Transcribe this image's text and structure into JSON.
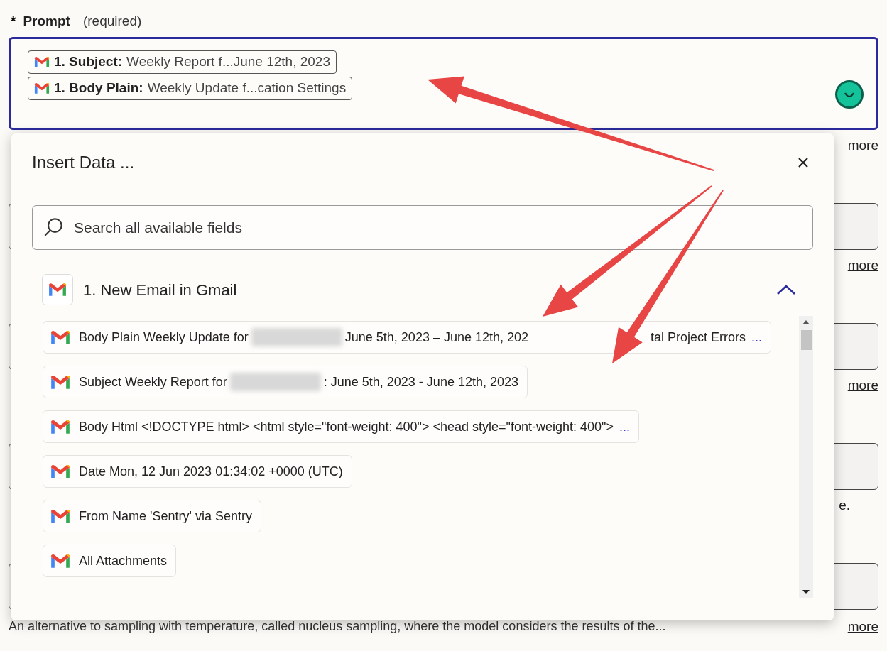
{
  "prompt": {
    "required_mark": "*",
    "label": "Prompt",
    "hint": "(required)",
    "tokens": [
      {
        "source": "1.",
        "field": "Subject:",
        "value": "Weekly Report f...June 12th, 2023"
      },
      {
        "source": "1.",
        "field": "Body Plain:",
        "value": "Weekly Update f...cation Settings"
      }
    ]
  },
  "background": [
    {
      "kind": "link",
      "text": "more"
    },
    {
      "kind": "field"
    },
    {
      "kind": "link",
      "text": "more"
    },
    {
      "kind": "field"
    },
    {
      "kind": "link",
      "text": "more"
    },
    {
      "kind": "field"
    },
    {
      "kind": "text",
      "text": "e."
    },
    {
      "kind": "field"
    },
    {
      "kind": "caption",
      "text": "An alternative to sampling with temperature, called nucleus sampling, where the model considers the results of the...",
      "link": "more"
    }
  ],
  "popup": {
    "title": "Insert Data ...",
    "search": {
      "placeholder": "Search all available fields"
    },
    "group": {
      "title": "1. New Email in Gmail",
      "expanded": true,
      "items": [
        {
          "parts": [
            {
              "kind": "text",
              "text": "Body Plain Weekly Update for"
            },
            {
              "kind": "redacted"
            },
            {
              "kind": "text",
              "text": "June 5th, 2023 – June 12th, 202"
            },
            {
              "kind": "gap"
            },
            {
              "kind": "text",
              "text": "tal Project Errors"
            },
            {
              "kind": "more",
              "text": "..."
            }
          ]
        },
        {
          "parts": [
            {
              "kind": "text",
              "text": "Subject Weekly Report for"
            },
            {
              "kind": "redacted"
            },
            {
              "kind": "text",
              "text": ": June 5th, 2023 - June 12th, 2023"
            }
          ]
        },
        {
          "parts": [
            {
              "kind": "text",
              "text": "Body Html <!DOCTYPE html> <html style=\"font-weight: 400\"> <head style=\"font-weight: 400\">"
            },
            {
              "kind": "more",
              "text": "..."
            }
          ]
        },
        {
          "parts": [
            {
              "kind": "text",
              "text": "Date Mon, 12 Jun 2023 01:34:02 +0000 (UTC)"
            }
          ]
        },
        {
          "parts": [
            {
              "kind": "text",
              "text": "From Name 'Sentry' via Sentry"
            }
          ]
        },
        {
          "parts": [
            {
              "kind": "text",
              "text": "All Attachments"
            }
          ]
        }
      ]
    }
  }
}
